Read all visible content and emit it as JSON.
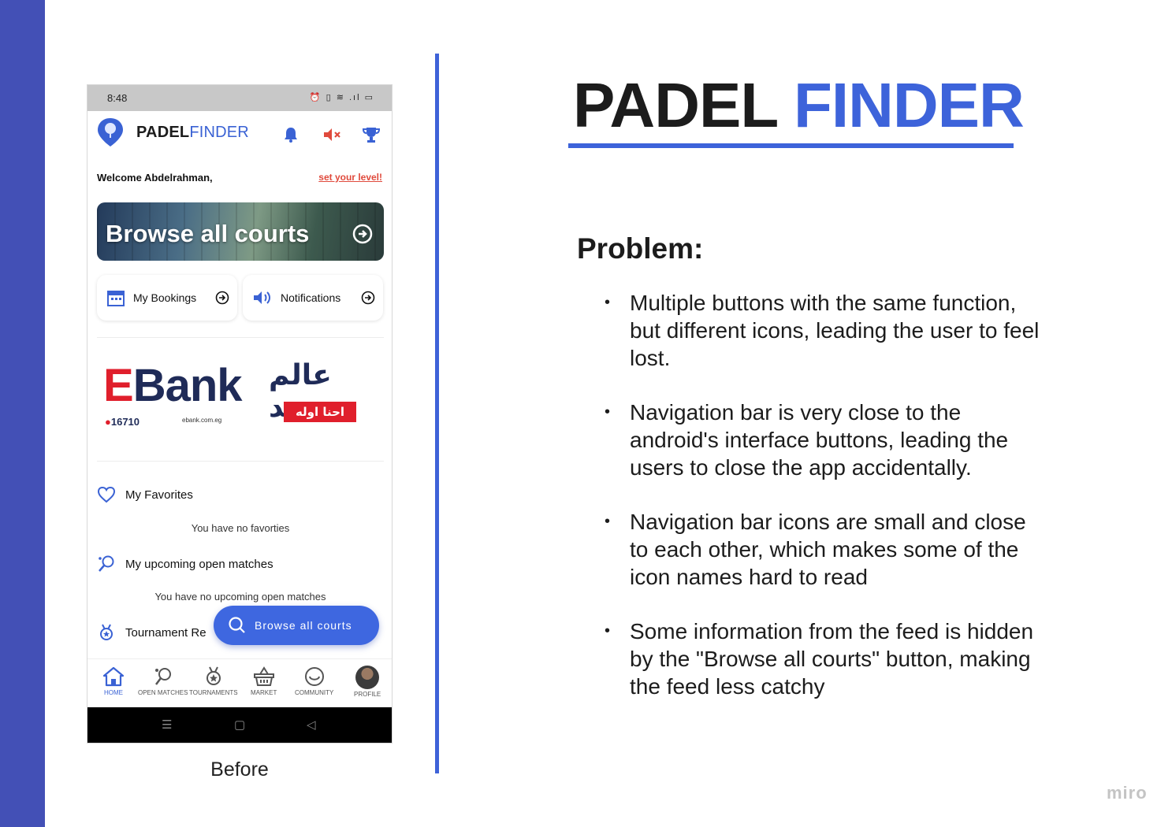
{
  "slide": {
    "title_part1": "PADEL",
    "title_part2": "FINDER",
    "problem_heading": "Problem:",
    "bullets": [
      "Multiple buttons with the same function, but different icons, leading the user to feel lost.",
      "Navigation bar is very close to the android's interface buttons, leading the users to close the app accidentally.",
      "Navigation bar icons are small and close to each other, which makes some of the icon names hard to read",
      "Some information from the feed is hidden by the \"Browse all courts\" button, making the feed less catchy"
    ],
    "caption": "Before",
    "watermark": "miro",
    "colors": {
      "accent": "#3d63da",
      "stripe": "#4350b6"
    }
  },
  "phone": {
    "status_time": "8:48",
    "brand_part1": "PADEL",
    "brand_part2": "FINDER",
    "appbar_icons": [
      "bell-icon",
      "mute-icon",
      "trophy-icon"
    ],
    "welcome": "Welcome Abdelrahman,",
    "set_level": "set your level!",
    "banner_label": "Browse all courts",
    "quick_bookings": "My Bookings",
    "quick_notifications": "Notifications",
    "ads": {
      "ebank_e": "E",
      "ebank_rest": "Bank",
      "ebank_phone": "16710",
      "ebank_site": "ebank.com.eg",
      "alam_title": "عالم جديد",
      "alam_sub": "احنا اوله"
    },
    "favorites_label": "My Favorites",
    "favorites_empty": "You have no favorties",
    "matches_label": "My upcoming open matches",
    "matches_empty": "You have no upcoming open matches",
    "tournament_label": "Tournament Re",
    "fab_label": "Browse all courts",
    "nav": [
      {
        "label": "HOME",
        "icon": "home-icon"
      },
      {
        "label": "OPEN MATCHES",
        "icon": "racket-icon"
      },
      {
        "label": "TOURNAMENTS",
        "icon": "medal-icon"
      },
      {
        "label": "MARKET",
        "icon": "basket-icon"
      },
      {
        "label": "COMMUNITY",
        "icon": "smile-icon"
      },
      {
        "label": "PROFILE",
        "icon": "avatar"
      }
    ],
    "sys_buttons": [
      "☰",
      "▢",
      "◁"
    ]
  }
}
